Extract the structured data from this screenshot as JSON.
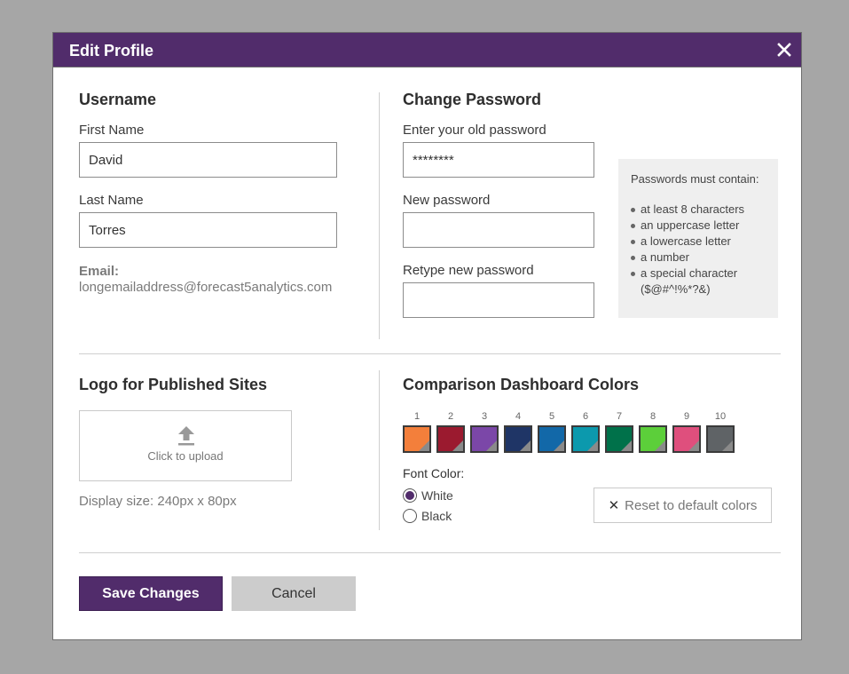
{
  "dialog": {
    "title": "Edit Profile",
    "close_icon": "close-icon"
  },
  "username": {
    "heading": "Username",
    "first_name_label": "First Name",
    "first_name_value": "David",
    "last_name_label": "Last Name",
    "last_name_value": "Torres",
    "email_label": "Email:",
    "email_value": "longemailaddress@forecast5analytics.com"
  },
  "password": {
    "heading": "Change Password",
    "old_label": "Enter your old password",
    "old_value": "********",
    "new_label": "New password",
    "new_value": "",
    "retype_label": "Retype new password",
    "retype_value": "",
    "hint_title": "Passwords must contain:",
    "hint_items": [
      "at least 8 characters",
      "an uppercase letter",
      "a lowercase letter",
      "a number",
      "a special character ($@#^!%*?&)"
    ]
  },
  "logo": {
    "heading": "Logo for Published Sites",
    "upload_icon": "upload-icon",
    "upload_text": "Click to upload",
    "display_size": "Display size: 240px x 80px"
  },
  "colors": {
    "heading": "Comparison Dashboard Colors",
    "swatches": [
      {
        "label": "1",
        "color": "#f37f3b"
      },
      {
        "label": "2",
        "color": "#9b1a2f"
      },
      {
        "label": "3",
        "color": "#7b47a8"
      },
      {
        "label": "4",
        "color": "#1f3566"
      },
      {
        "label": "5",
        "color": "#1268a8"
      },
      {
        "label": "6",
        "color": "#0c99ad"
      },
      {
        "label": "7",
        "color": "#00714a"
      },
      {
        "label": "8",
        "color": "#5ccf3a"
      },
      {
        "label": "9",
        "color": "#df4f7d"
      },
      {
        "label": "10",
        "color": "#5f6366"
      }
    ],
    "font_color_label": "Font Color:",
    "font_color_options": [
      {
        "label": "White",
        "selected": true
      },
      {
        "label": "Black",
        "selected": false
      }
    ],
    "reset_label": "Reset to default colors"
  },
  "actions": {
    "save_label": "Save Changes",
    "cancel_label": "Cancel"
  },
  "theme": {
    "primary": "#512c6b",
    "overlay": "#a6a6a6"
  }
}
